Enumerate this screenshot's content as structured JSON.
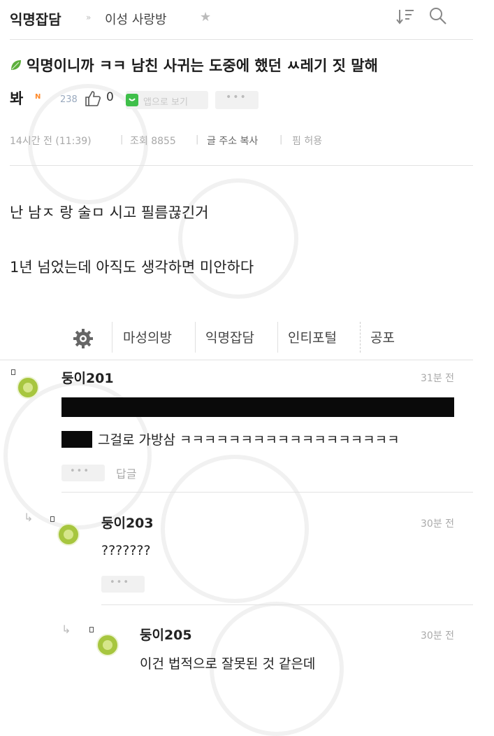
{
  "header": {
    "title": "익명잡담",
    "separator": "»",
    "board": "이성 사랑방",
    "star_icon": "star-icon",
    "sort_icon": "sort-icon",
    "search_icon": "search-icon"
  },
  "post": {
    "title_line1": "익명이니까 ㅋㅋ 남친 사귀는 도중에 했던 ㅆ레기 짓 말해",
    "title_line2": "봐",
    "new_badge": "N",
    "count_a": "238",
    "like_count": "0",
    "app_view_label": "앱으로 보기",
    "more_label": "•••",
    "meta": {
      "time": "14시간 전 (11:39)",
      "views": "조회 8855",
      "copy_address": "글 주소 복사",
      "pin": "핌 허용"
    },
    "body": [
      "난 남ㅈ 랑 술ㅁ 시고 필름끊긴거",
      "1년 넘었는데 아직도 생각하면 미안하다"
    ]
  },
  "board_tabs": [
    "마성의방",
    "익명잡담",
    "인티포털",
    "공포"
  ],
  "comments": [
    {
      "name": "둥이201",
      "time": "31분 전",
      "text": "그걸로 가방삼 ㅋㅋㅋㅋㅋㅋㅋㅋㅋㅋㅋㅋㅋㅋㅋㅋㅋㅋ",
      "more": "•••",
      "reply_label": "답글"
    },
    {
      "name": "둥이203",
      "time": "30분 전",
      "text": "???????",
      "more": "•••"
    },
    {
      "name": "둥이205",
      "time": "30분 전",
      "text": "이건 법적으로 잘못된 것 같은데"
    }
  ],
  "colors": {
    "avatar": "#a7c63f",
    "app_icon": "#3fbf4a",
    "new_badge": "#ff8a2a",
    "redaction": "#0a0a0a"
  }
}
